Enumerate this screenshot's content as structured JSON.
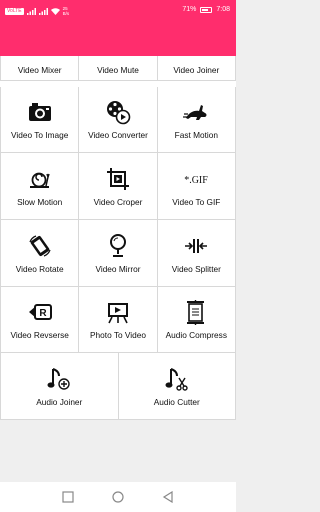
{
  "status_bar": {
    "left_chip": "VoLTE",
    "net_speed": "25 B/s",
    "battery_pct": "71%",
    "time": "7:08",
    "icons": [
      "sim-icon",
      "signal-icon",
      "wifi-icon",
      "battery-icon"
    ]
  },
  "colors": {
    "header": "#ff2d6d",
    "grid_bg": "#ffffff",
    "page_bg": "#efefef"
  },
  "tools": {
    "row0": [
      {
        "label": "Video Mixer"
      },
      {
        "label": "Video Mute"
      },
      {
        "label": "Video Joiner"
      }
    ],
    "row1": [
      {
        "label": "Video To Image",
        "icon": "camera-icon"
      },
      {
        "label": "Video Converter",
        "icon": "reel-icon"
      },
      {
        "label": "Fast Motion",
        "icon": "rabbit-icon"
      }
    ],
    "row2": [
      {
        "label": "Slow Motion",
        "icon": "snail-icon"
      },
      {
        "label": "Video Croper",
        "icon": "crop-icon"
      },
      {
        "label": "Video To GIF",
        "icon": "gif-icon",
        "icon_text": "*.GIF"
      }
    ],
    "row3": [
      {
        "label": "Video Rotate",
        "icon": "rotate-icon"
      },
      {
        "label": "Video Mirror",
        "icon": "mirror-icon"
      },
      {
        "label": "Video Splitter",
        "icon": "splitter-icon"
      }
    ],
    "row4": [
      {
        "label": "Video Revserse",
        "icon": "reverse-icon"
      },
      {
        "label": "Photo To Video",
        "icon": "film-board-icon"
      },
      {
        "label": "Audio Compress",
        "icon": "compress-icon"
      }
    ],
    "row5": [
      {
        "label": "Audio Joiner",
        "icon": "music-add-icon"
      },
      {
        "label": "Audio Cutter",
        "icon": "music-cut-icon"
      }
    ]
  },
  "nav": {
    "icons": [
      "recents-square-icon",
      "home-circle-icon",
      "back-triangle-icon"
    ]
  }
}
